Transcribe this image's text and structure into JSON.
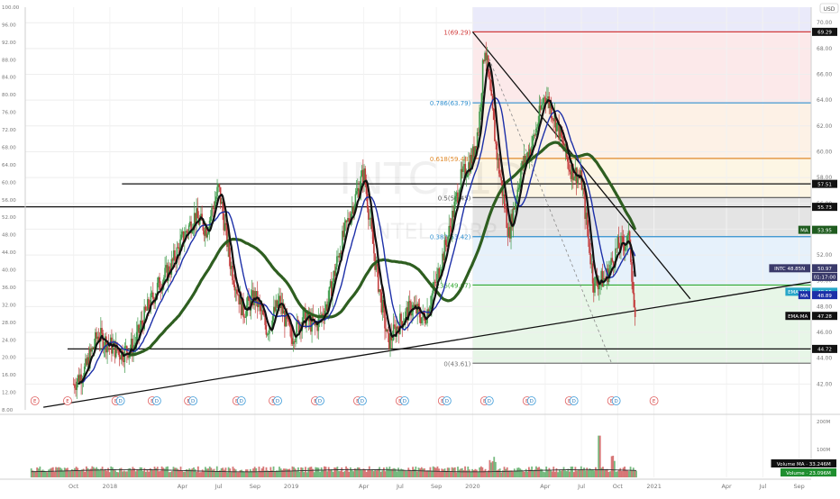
{
  "chart_data": {
    "type": "line",
    "symbol": "INTC",
    "currency": "USD",
    "watermark": "INTC, 1D",
    "watermark_sub": "INTEL CORP",
    "right_axis": {
      "ylim": [
        40.0,
        71.2
      ],
      "ticks": [
        42.0,
        44.0,
        46.0,
        48.0,
        50.0,
        52.0,
        54.0,
        56.0,
        58.0,
        60.0,
        62.0,
        64.0,
        66.0,
        68.0,
        70.0
      ],
      "tick_labels": [
        "42.00",
        "44.00",
        "46.00",
        "48.00",
        "50.00",
        "52.00",
        "54.00",
        "56.00",
        "58.00",
        "60.00",
        "62.00",
        "64.00",
        "66.00",
        "68.00",
        "70.00"
      ]
    },
    "left_axis": {
      "ylim": [
        8.0,
        100.0
      ],
      "ticks": [
        8.0,
        12.0,
        16.0,
        20.0,
        24.0,
        28.0,
        32.0,
        36.0,
        40.0,
        44.0,
        48.0,
        52.0,
        56.0,
        60.0,
        64.0,
        68.0,
        72.0,
        76.0,
        80.0,
        84.0,
        88.0,
        92.0,
        96.0,
        100.0
      ],
      "tick_labels": [
        "8.00",
        "12.00",
        "16.00",
        "20.00",
        "24.00",
        "28.00",
        "32.00",
        "36.00",
        "40.00",
        "44.00",
        "48.00",
        "52.00",
        "56.00",
        "60.00",
        "64.00",
        "68.00",
        "72.00",
        "76.00",
        "80.00",
        "84.00",
        "88.00",
        "92.00",
        "96.00",
        "100.00"
      ]
    },
    "time_axis": {
      "labels": [
        "Oct",
        "2018",
        "Apr",
        "Jul",
        "Sep",
        "2019",
        "Apr",
        "Jul",
        "Sep",
        "2020",
        "Apr",
        "Jul",
        "Oct",
        "2021",
        "Apr",
        "Jul",
        "Sep"
      ],
      "positions": [
        0,
        3,
        9,
        12,
        15,
        18,
        24,
        27,
        30,
        33,
        39,
        42,
        45,
        48,
        54,
        57,
        60
      ]
    },
    "price_series": {
      "name": "INTC",
      "t": [
        0,
        1,
        2,
        3,
        4,
        5,
        6,
        7,
        8,
        9,
        10,
        11,
        12,
        13,
        14,
        15,
        16,
        17,
        18,
        19,
        20,
        21,
        22,
        23,
        24,
        25,
        26,
        27,
        28,
        29,
        30,
        31,
        32,
        33,
        33.5,
        34,
        35,
        36,
        37,
        38,
        39,
        40,
        41,
        42,
        43,
        44,
        45,
        46,
        46.5
      ],
      "value": [
        42.0,
        43.2,
        45.8,
        45.0,
        44.4,
        45.0,
        47.6,
        49.6,
        51.0,
        53.2,
        55.0,
        54.0,
        57.2,
        51.2,
        47.6,
        48.8,
        46.2,
        48.4,
        45.6,
        47.2,
        46.4,
        48.2,
        52.4,
        55.6,
        58.4,
        51.0,
        45.2,
        46.8,
        48.0,
        47.0,
        50.0,
        53.6,
        57.8,
        59.6,
        62.0,
        68.4,
        59.8,
        53.6,
        58.6,
        60.8,
        64.6,
        62.0,
        58.8,
        57.8,
        49.8,
        50.2,
        52.6,
        53.2,
        45.6
      ]
    },
    "ma50_label": "EMA:MA",
    "ma200_label": "MA",
    "fibonacci": [
      {
        "label": "1(69.29)",
        "value": 69.29
      },
      {
        "label": "0.786(63.79)",
        "value": 63.79
      },
      {
        "label": "0.618(59.48)",
        "value": 59.48
      },
      {
        "label": "0.5(56.45)",
        "value": 56.45
      },
      {
        "label": "0.382(53.42)",
        "value": 53.42
      },
      {
        "label": "0.236(49.67)",
        "value": 49.67
      },
      {
        "label": "0(43.61)",
        "value": 43.61
      }
    ],
    "horizontal_levels": [
      57.51,
      55.73,
      44.72
    ],
    "price_badges": [
      {
        "label": "69.29",
        "value": 69.29,
        "color": "#111111"
      },
      {
        "label": "57.51",
        "value": 57.51,
        "color": "#111111"
      },
      {
        "label": "55.73",
        "value": 55.73,
        "color": "#111111"
      },
      {
        "label": "MA",
        "label2": "53.95",
        "value": 53.95,
        "color": "#1f5c1f"
      },
      {
        "label": "INTC 48.85N",
        "label2": "50.97",
        "value": 50.97,
        "color": "#3a3a6a"
      },
      {
        "label": "",
        "label2": "01:17:00",
        "value": 50.3,
        "color": "#3a3a6a"
      },
      {
        "label": "EMA:MA",
        "label2": "49.15",
        "value": 49.15,
        "color": "#26a6c8"
      },
      {
        "label": "MA",
        "label2": "48.89",
        "value": 48.89,
        "color": "#1c2fa8"
      },
      {
        "label": "EMA:MA",
        "label2": "47.28",
        "value": 47.28,
        "color": "#111111"
      },
      {
        "label": "",
        "label2": "44.72",
        "value": 44.72,
        "color": "#111111"
      }
    ],
    "volume": {
      "axis_labels": [
        "200M",
        "100M"
      ],
      "legend": [
        {
          "label": "Volume MA",
          "value": "33.246M",
          "color": "#111111"
        },
        {
          "label": "Volume",
          "value": "23.096M",
          "color": "#1f8f2f"
        }
      ]
    },
    "event_markers": [
      "E",
      "D"
    ]
  }
}
